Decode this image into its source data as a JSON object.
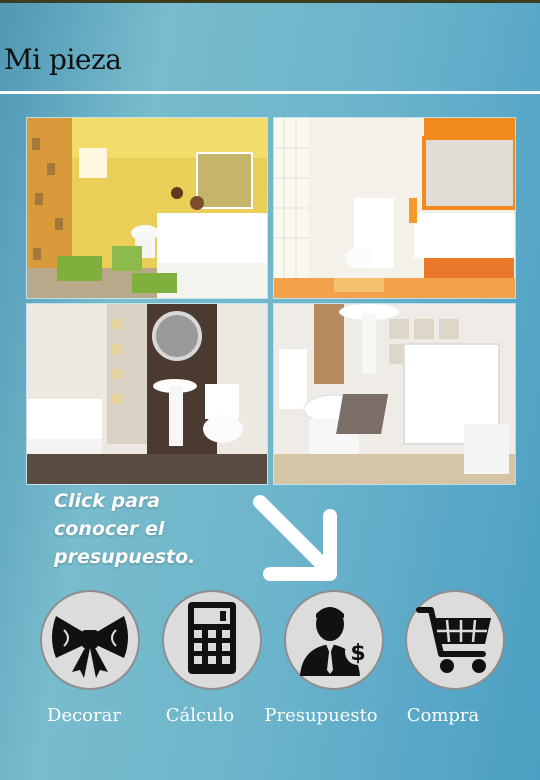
{
  "header": {
    "title": "Mi pieza"
  },
  "gallery": {
    "images": [
      {
        "name": "yellow-bathroom"
      },
      {
        "name": "orange-bathroom"
      },
      {
        "name": "dark-wall-bathroom"
      },
      {
        "name": "white-bathroom"
      }
    ]
  },
  "cta": {
    "line1": "Click para",
    "line2": "conocer el",
    "line3": "presupuesto."
  },
  "menu": {
    "items": [
      {
        "label": "Decorar",
        "icon": "bow-icon"
      },
      {
        "label": "Cálculo",
        "icon": "calculator-icon"
      },
      {
        "label": "Presupuesto",
        "icon": "person-money-icon"
      },
      {
        "label": "Compra",
        "icon": "cart-icon"
      }
    ]
  },
  "colors": {
    "background": "#6db5cb",
    "button_bg": "#dcdcdc",
    "icon": "#111111",
    "text_light": "#ffffff"
  }
}
